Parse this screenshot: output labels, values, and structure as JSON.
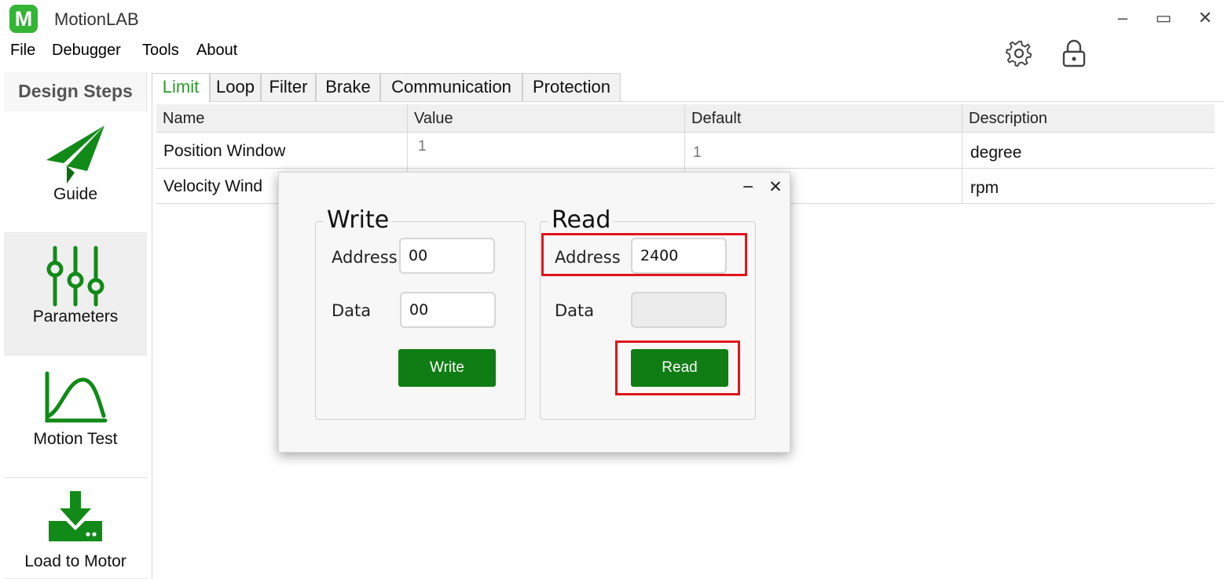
{
  "app": {
    "logo_letter": "M",
    "title": "MotionLAB"
  },
  "window_controls": {
    "minimize": "‒",
    "maximize": "▭",
    "close": "✕"
  },
  "menu": [
    "File",
    "Debugger",
    "Tools",
    "About"
  ],
  "toolbar_icons": [
    "gear-icon",
    "lock-icon"
  ],
  "sidebar": {
    "title": "Design Steps",
    "items": [
      {
        "label": "Guide",
        "icon": "paper-plane-icon"
      },
      {
        "label": "Parameters",
        "icon": "sliders-icon",
        "active": true
      },
      {
        "label": "Motion Test",
        "icon": "curve-chart-icon"
      },
      {
        "label": "Load to Motor",
        "icon": "download-icon"
      }
    ]
  },
  "tabs": [
    "Limit",
    "Loop",
    "Filter",
    "Brake",
    "Communication",
    "Protection"
  ],
  "active_tab": "Limit",
  "table": {
    "columns": [
      "Name",
      "Value",
      "Default",
      "Description"
    ],
    "rows": [
      {
        "name": "Position Window",
        "value": "1",
        "default": "1",
        "description": "degree"
      },
      {
        "name": "Velocity Wind",
        "value": "",
        "default": "",
        "description": "rpm"
      }
    ]
  },
  "dialog": {
    "minimize": "−",
    "close": "✕",
    "write": {
      "title": "Write",
      "address_label": "Address",
      "address_value": "00",
      "data_label": "Data",
      "data_value": "00",
      "button": "Write"
    },
    "read": {
      "title": "Read",
      "address_label": "Address",
      "address_value": "2400",
      "data_label": "Data",
      "data_value": "",
      "button": "Read"
    }
  },
  "colors": {
    "accent_green": "#35b535",
    "button_green": "#0f7d14",
    "highlight_red": "#e0141c"
  }
}
